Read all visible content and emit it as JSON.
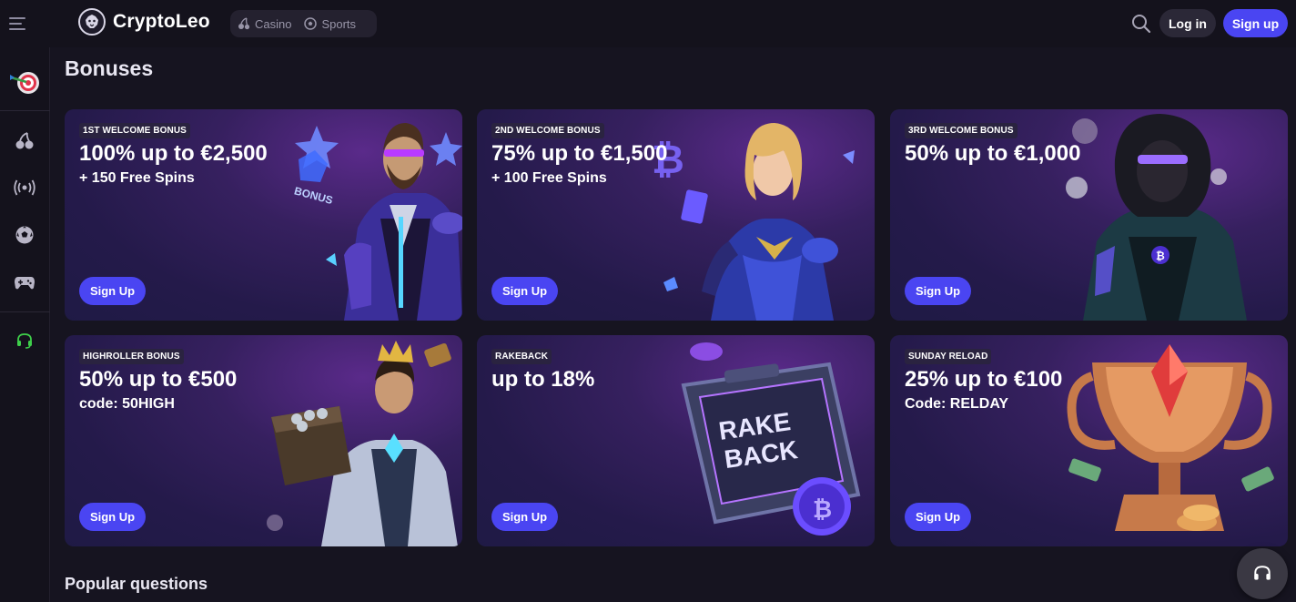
{
  "header": {
    "brand": "CryptoLeo",
    "nav": [
      {
        "label": "Casino",
        "icon": "cherries-icon"
      },
      {
        "label": "Sports",
        "icon": "soccer-ball-icon"
      }
    ],
    "login_label": "Log in",
    "signup_label": "Sign up"
  },
  "sidebar": {
    "items": [
      "dart-target-icon",
      "cherries-icon",
      "live-broadcast-icon",
      "soccer-ball-icon",
      "gamepad-icon",
      "headset-icon"
    ]
  },
  "page": {
    "title": "Bonuses",
    "section_title": "Popular questions"
  },
  "bonuses": [
    {
      "badge": "1ST WELCOME BONUS",
      "title": "100% up to €2,500",
      "subtitle": "+ 150 Free Spins",
      "button": "Sign Up"
    },
    {
      "badge": "2ND WELCOME BONUS",
      "title": "75% up to €1,500",
      "subtitle": "+ 100 Free Spins",
      "button": "Sign Up"
    },
    {
      "badge": "3RD WELCOME BONUS",
      "title": "50% up to €1,000",
      "subtitle": "",
      "button": "Sign Up"
    },
    {
      "badge": "HIGHROLLER BONUS",
      "title": "50% up to €500",
      "subtitle": "code: 50HIGH",
      "button": "Sign Up"
    },
    {
      "badge": "RAKEBACK",
      "title": "up to 18%",
      "subtitle": "",
      "button": "Sign Up"
    },
    {
      "badge": "SUNDAY RELOAD",
      "title": "25% up to €100",
      "subtitle": "Code: RELDAY",
      "button": "Sign Up"
    }
  ],
  "art_text": {
    "bonus_gem": "BONUS",
    "rakeback_line1": "RAKE",
    "rakeback_line2": "BACK"
  },
  "colors": {
    "background": "#161420",
    "accent": "#4a45f2",
    "card_purple": "#36205f",
    "support_green": "#3ecf4a"
  }
}
